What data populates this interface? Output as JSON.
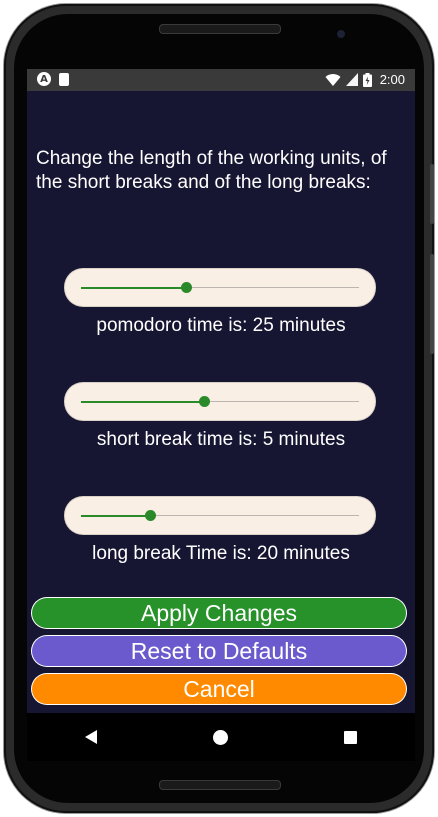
{
  "status_bar": {
    "left_icons": [
      "app-a-icon",
      "sd-card-icon"
    ],
    "right_icons": [
      "wifi-icon",
      "signal-icon",
      "battery-icon"
    ],
    "app_icon_letter": "A",
    "time": "2:00"
  },
  "settings": {
    "intro_text": "Change the length of the working units, of the short breaks and of the long breaks:",
    "sliders": [
      {
        "label": "pomodoro time is: 25 minutes",
        "value_fraction": 0.38
      },
      {
        "label": "short break time is: 5 minutes",
        "value_fraction": 0.445
      },
      {
        "label": "long break Time is: 20 minutes",
        "value_fraction": 0.25
      }
    ]
  },
  "buttons": {
    "apply": "Apply Changes",
    "reset": "Reset to Defaults",
    "cancel": "Cancel"
  },
  "colors": {
    "background": "#161633",
    "slider_bg": "#f9efe5",
    "slider_accent": "#2a8a2a",
    "apply": "#27912a",
    "reset": "#6a5acd",
    "cancel": "#ff8a00"
  },
  "nav_bar": {
    "icons": [
      "back-icon",
      "home-icon",
      "recents-icon"
    ]
  }
}
